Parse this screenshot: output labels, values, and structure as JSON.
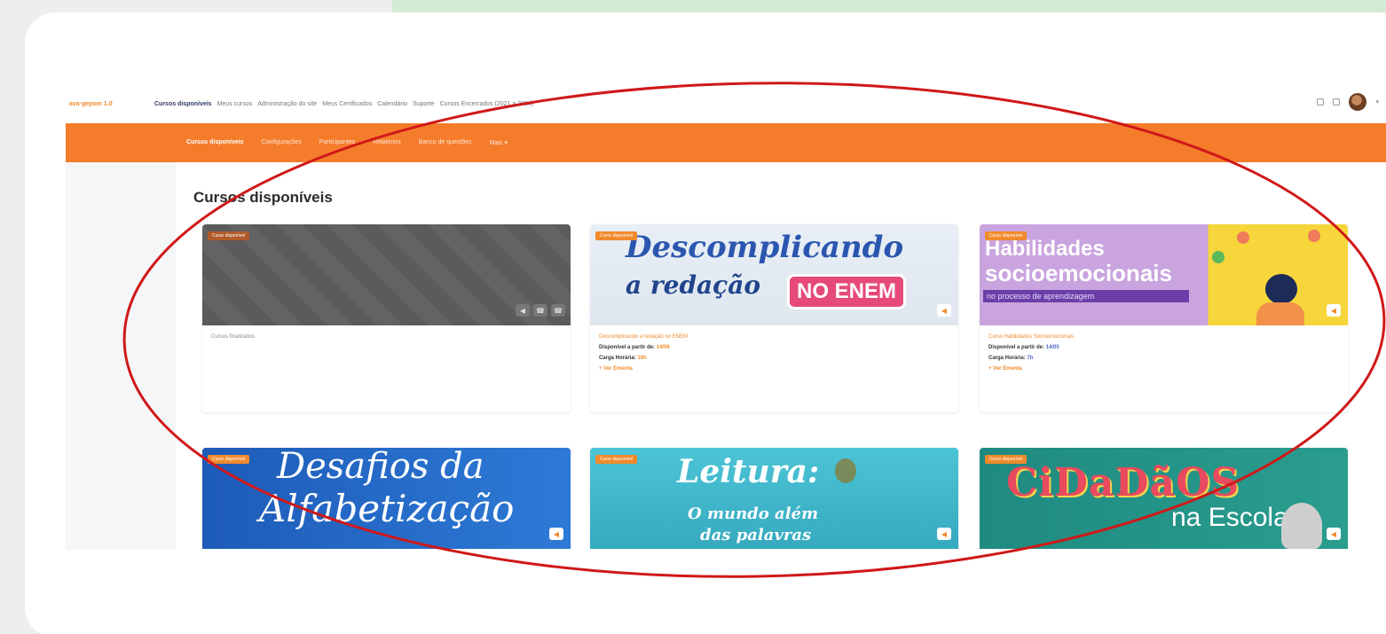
{
  "header": {
    "brand": "ava·gepom 1.0",
    "nav": [
      "Cursos disponíveis",
      "Meus cursos",
      "Administração do site",
      "Meus Certificados",
      "Calendário",
      "Suporte",
      "Cursos Encerrados (2021 a 2024)"
    ]
  },
  "subnav": [
    "Cursos disponíveis",
    "Configurações",
    "Participantes",
    "Relatórios",
    "Banco de questões",
    "Mais ▾"
  ],
  "page": {
    "title": "Cursos disponíveis"
  },
  "courses": [
    {
      "badge": "Curso disponível",
      "name": "Cursos finalizados",
      "banner": "",
      "banner2": "",
      "banner3": ""
    },
    {
      "badge": "Curso disponível",
      "name": "Descomplicando a redação no ENEM",
      "avail_label": "Disponível a partir de:",
      "avail_value": "14/06",
      "load_label": "Carga Horária:",
      "load_value": "10h",
      "link": "+ Ver Ementa",
      "banner": "Descomplicando",
      "banner2": "a redação",
      "banner3": "NO ENEM"
    },
    {
      "badge": "Curso disponível",
      "name": "Curso Habilidades Socioemocionais",
      "avail_label": "Disponível a partir de:",
      "avail_value": "14/05",
      "load_label": "Carga Horária:",
      "load_value": "7h",
      "link": "+ Ver Ementa",
      "banner": "Habilidades",
      "banner2": "socioemocionais",
      "banner3": "no processo de aprendizagem"
    },
    {
      "badge": "Curso disponível",
      "name": "",
      "banner": "Desafios da",
      "banner2": "Alfabetização",
      "banner3": ""
    },
    {
      "badge": "Curso disponível",
      "name": "",
      "banner": "Leitura:",
      "banner2": "O mundo além",
      "banner3": "das palavras"
    },
    {
      "badge": "Curso disponível",
      "name": "",
      "banner": "CiDaDãOS",
      "banner2": "na Escola",
      "banner3": ""
    }
  ],
  "colors": {
    "orange": "#f57c2b",
    "annotation_red": "#d01818",
    "accent_green": "#d3ebd3"
  }
}
